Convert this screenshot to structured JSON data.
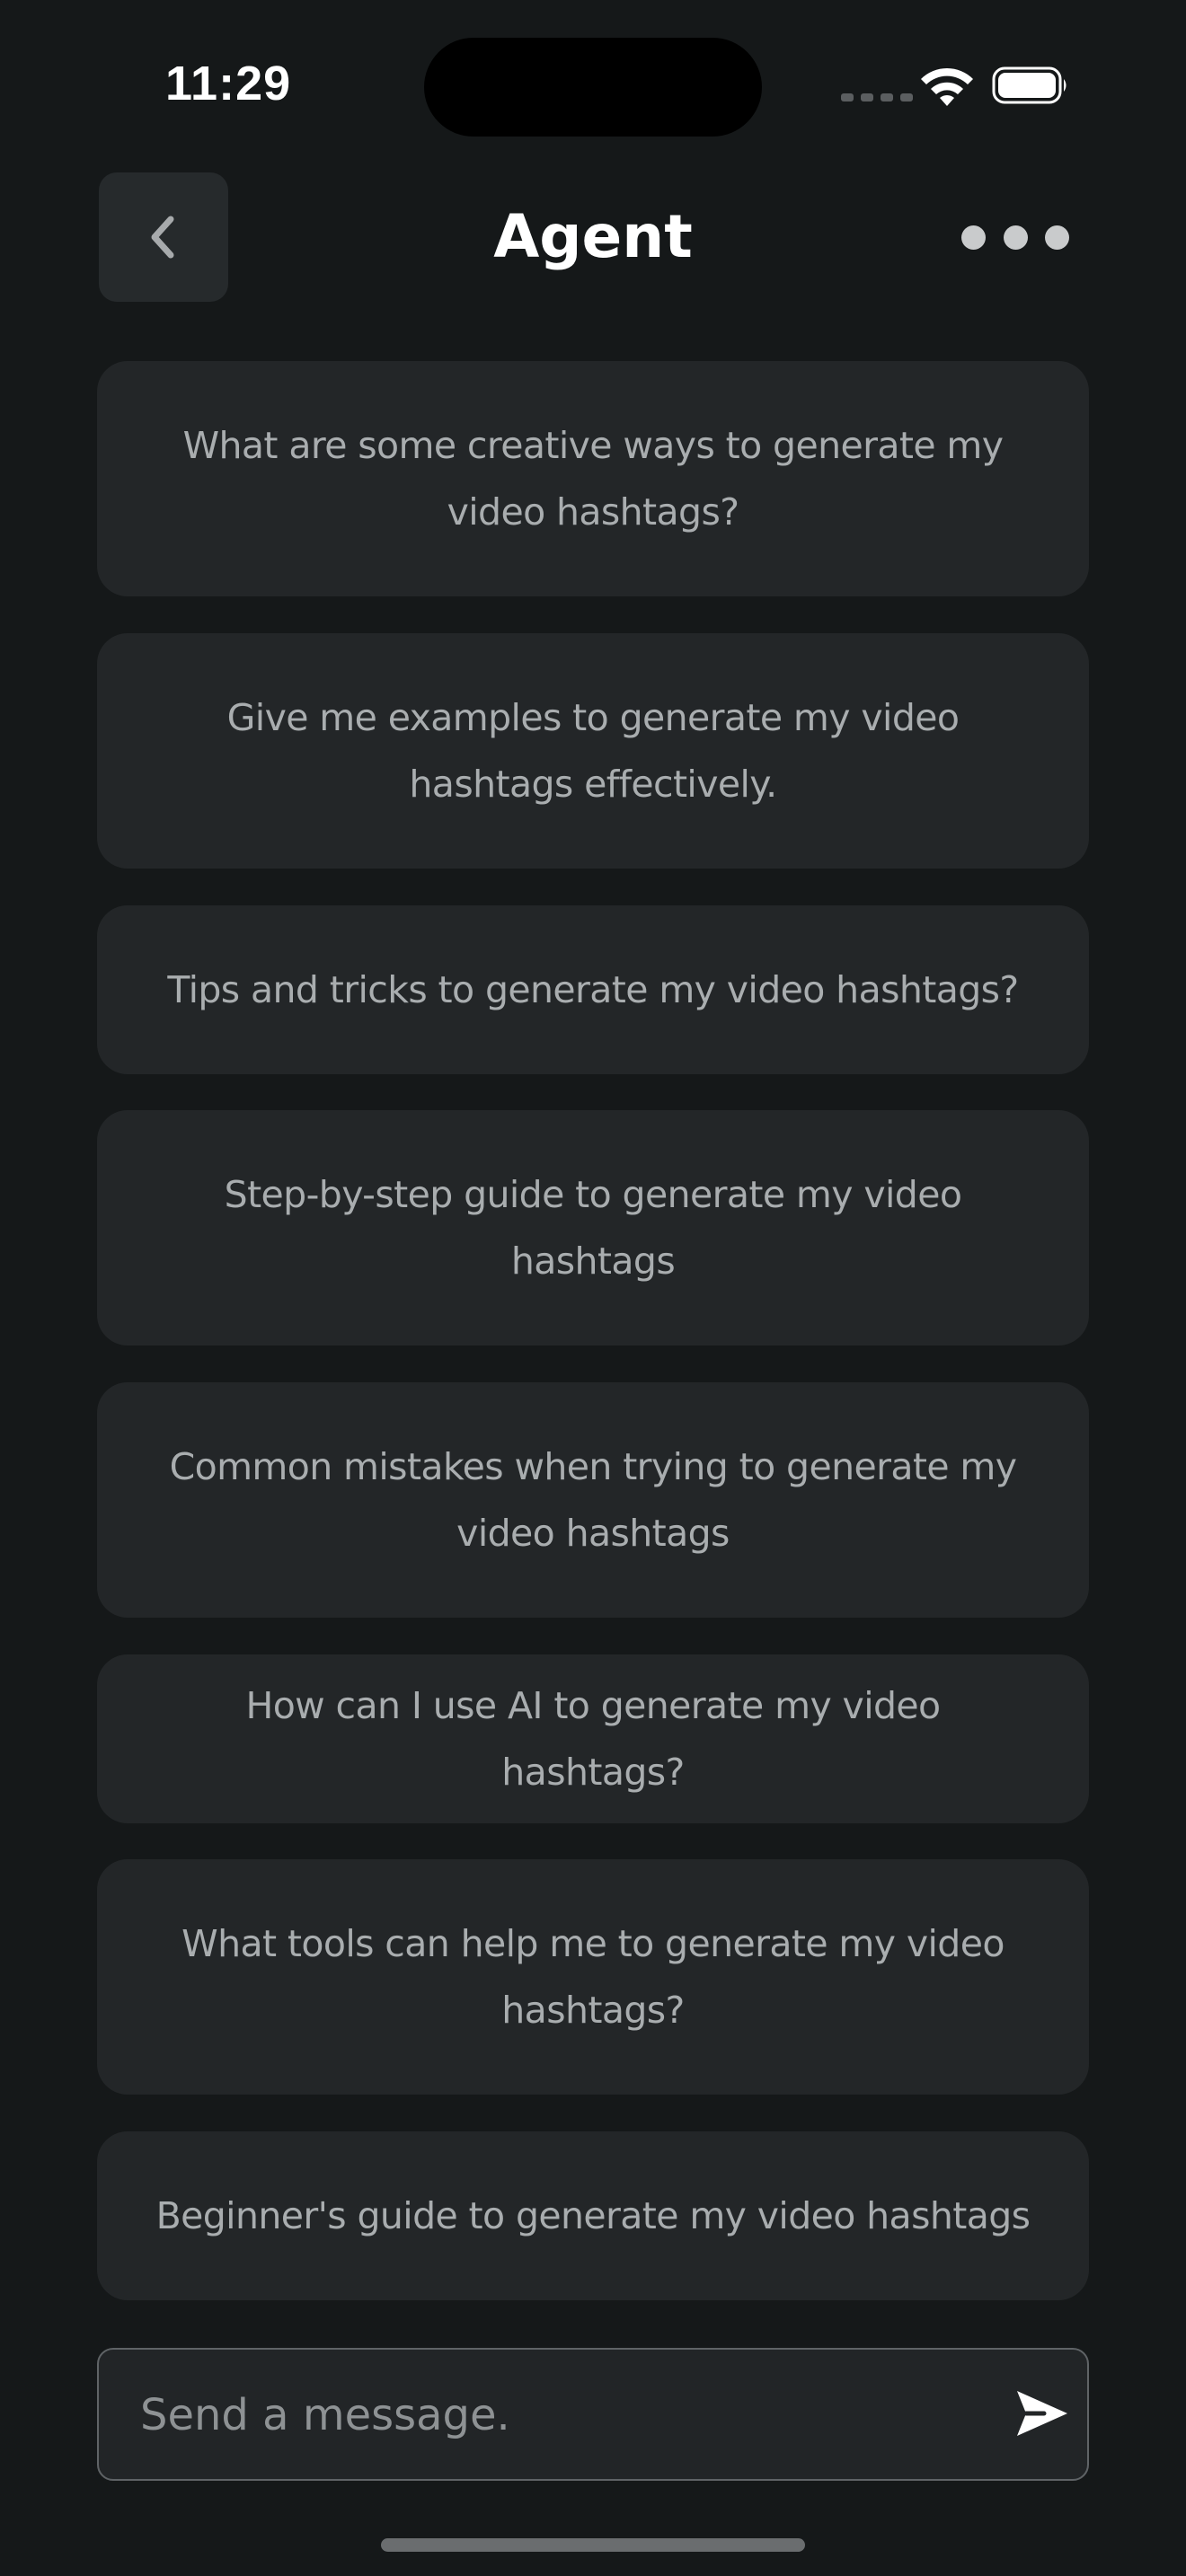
{
  "status_bar": {
    "time": "11:29"
  },
  "header": {
    "title": "Agent",
    "back_icon": "chevron-left-icon",
    "more_icon": "more-horizontal-icon"
  },
  "suggestions": [
    {
      "text": "What are some creative ways to generate my video hashtags?"
    },
    {
      "text": "Give me examples to generate my video hashtags effectively."
    },
    {
      "text": "Tips and tricks to generate my video hashtags?"
    },
    {
      "text": "Step-by-step guide to generate my video hashtags"
    },
    {
      "text": "Common mistakes when trying to generate my video hashtags"
    },
    {
      "text": "How can I use AI to generate my video hashtags?"
    },
    {
      "text": "What tools can help me to generate my video hashtags?"
    },
    {
      "text": "Beginner's guide to generate my video hashtags"
    }
  ],
  "composer": {
    "placeholder": "Send a message.",
    "value": "",
    "send_icon": "send-icon"
  },
  "colors": {
    "background": "#151819",
    "card": "#232628",
    "card_text": "#a9adaf",
    "title": "#ffffff"
  }
}
